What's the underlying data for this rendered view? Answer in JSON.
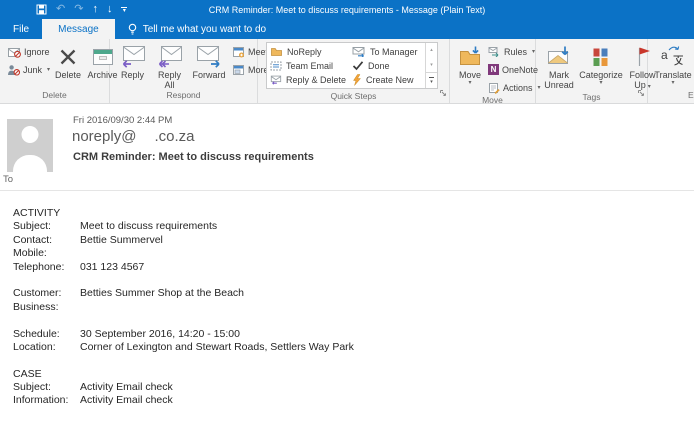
{
  "titlebar": {
    "title": "CRM Reminder: Meet to discuss requirements - Message (Plain Text)"
  },
  "tabs": {
    "file": "File",
    "message": "Message",
    "tell_me": "Tell me what you want to do"
  },
  "ribbon": {
    "delete_group": {
      "label": "Delete",
      "ignore": "Ignore",
      "junk": "Junk",
      "delete": "Delete",
      "archive": "Archive"
    },
    "respond_group": {
      "label": "Respond",
      "reply": "Reply",
      "reply_all_l1": "Reply",
      "reply_all_l2": "All",
      "forward": "Forward",
      "meeting": "Meeting",
      "more": "More"
    },
    "quick_steps_group": {
      "label": "Quick Steps",
      "items": [
        "NoReply",
        "Team Email",
        "Reply & Delete",
        "To Manager",
        "Done",
        "Create New"
      ]
    },
    "move_group": {
      "label": "Move",
      "move": "Move",
      "rules": "Rules",
      "onenote": "OneNote",
      "actions": "Actions"
    },
    "tags_group": {
      "label": "Tags",
      "mark_unread_l1": "Mark",
      "mark_unread_l2": "Unread",
      "categorize": "Categorize",
      "follow_up_l1": "Follow",
      "follow_up_l2": "Up"
    },
    "editing_group": {
      "label": "E",
      "translate": "Translate"
    }
  },
  "message_header": {
    "date": "Fri 2016/09/30 2:44 PM",
    "from_prefix": "noreply@",
    "from_suffix": ".co.za",
    "subject": "CRM Reminder: Meet to discuss requirements",
    "to_label": "To"
  },
  "body": {
    "rows": [
      {
        "label": "ACTIVITY",
        "value": ""
      },
      {
        "label": "Subject:",
        "value": "Meet to discuss requirements"
      },
      {
        "label": "Contact:",
        "value": "Bettie Summervel"
      },
      {
        "label": "Mobile:",
        "value": ""
      },
      {
        "label": "Telephone:",
        "value": "031 123 4567"
      },
      {
        "label": "",
        "value": ""
      },
      {
        "label": "Customer:",
        "value": "Betties Summer Shop at the Beach"
      },
      {
        "label": "Business:",
        "value": ""
      },
      {
        "label": "",
        "value": ""
      },
      {
        "label": "Schedule:",
        "value": "30 September 2016, 14:20 - 15:00"
      },
      {
        "label": "Location:",
        "value": "Corner of Lexington and Stewart Roads, Settlers Way Park"
      },
      {
        "label": "",
        "value": ""
      },
      {
        "label": "CASE",
        "value": ""
      },
      {
        "label": "Subject:",
        "value": "Activity Email check"
      },
      {
        "label": "Information:",
        "value": "Activity Email check"
      }
    ]
  }
}
